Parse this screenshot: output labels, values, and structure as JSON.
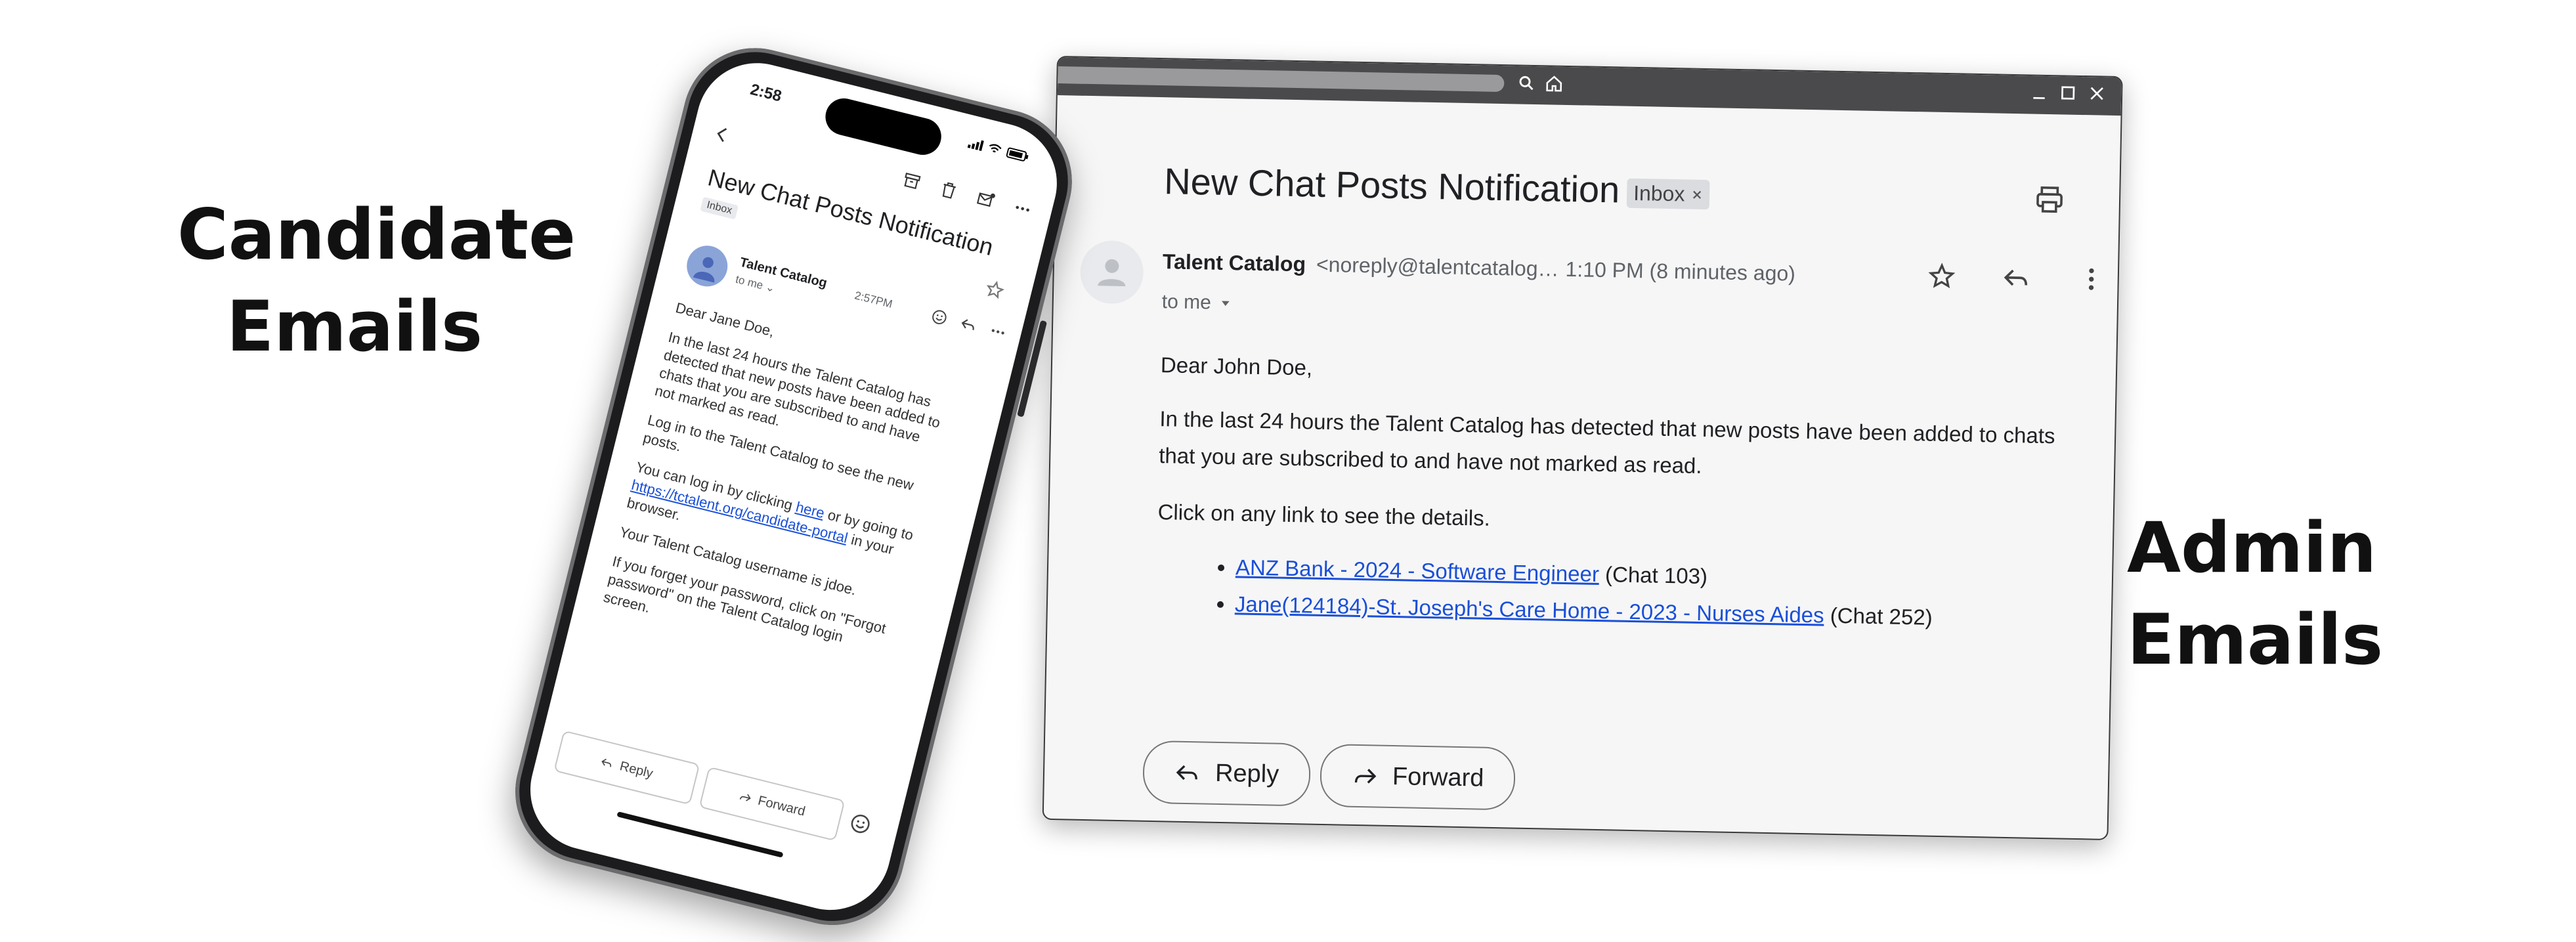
{
  "captions": {
    "left": [
      "Candidate",
      "Emails"
    ],
    "right": [
      "Admin",
      "Emails"
    ]
  },
  "desktop": {
    "subject": "New Chat Posts Notification",
    "label_chip": "Inbox",
    "sender_name": "Talent Catalog",
    "sender_address": "<noreply@talentcatalog…",
    "time": "1:10 PM (8 minutes ago)",
    "recipient": "to me",
    "greeting": "Dear John Doe,",
    "paragraph1": "In the last 24 hours the Talent Catalog has detected that new posts have been added to chats that you are subscribed to and have not marked as read.",
    "paragraph2": "Click on any link to see the details.",
    "links": [
      {
        "text": "ANZ Bank - 2024 - Software Engineer",
        "suffix": " (Chat 103)"
      },
      {
        "text": "Jane(124184)-St. Joseph's Care Home - 2023 - Nurses Aides",
        "suffix": " (Chat 252)"
      }
    ],
    "reply_label": "Reply",
    "forward_label": "Forward"
  },
  "phone": {
    "clock": "2:58",
    "subject": "New Chat Posts Notification",
    "label_chip": "Inbox",
    "sender_name": "Talent Catalog",
    "recipient": "to me ⌄",
    "time": "2:57PM",
    "greeting": "Dear Jane Doe,",
    "paragraph1": "In the last 24 hours the Talent Catalog has detected that new posts have been added to chats that you are subscribed to and have not marked as read.",
    "paragraph2": "Log in to the Talent Catalog to see the new posts.",
    "p3_pre": "You can log in by clicking ",
    "p3_link1": "here",
    "p3_mid": " or by going to ",
    "p3_link2": "https://tctalent.org/candidate-portal",
    "p3_post": " in your browser.",
    "paragraph4": "Your Talent Catalog username is jdoe.",
    "paragraph5": "If you forget your password, click on \"Forgot password\" on the Talent Catalog login screen.",
    "reply_label": "Reply",
    "forward_label": "Forward"
  }
}
